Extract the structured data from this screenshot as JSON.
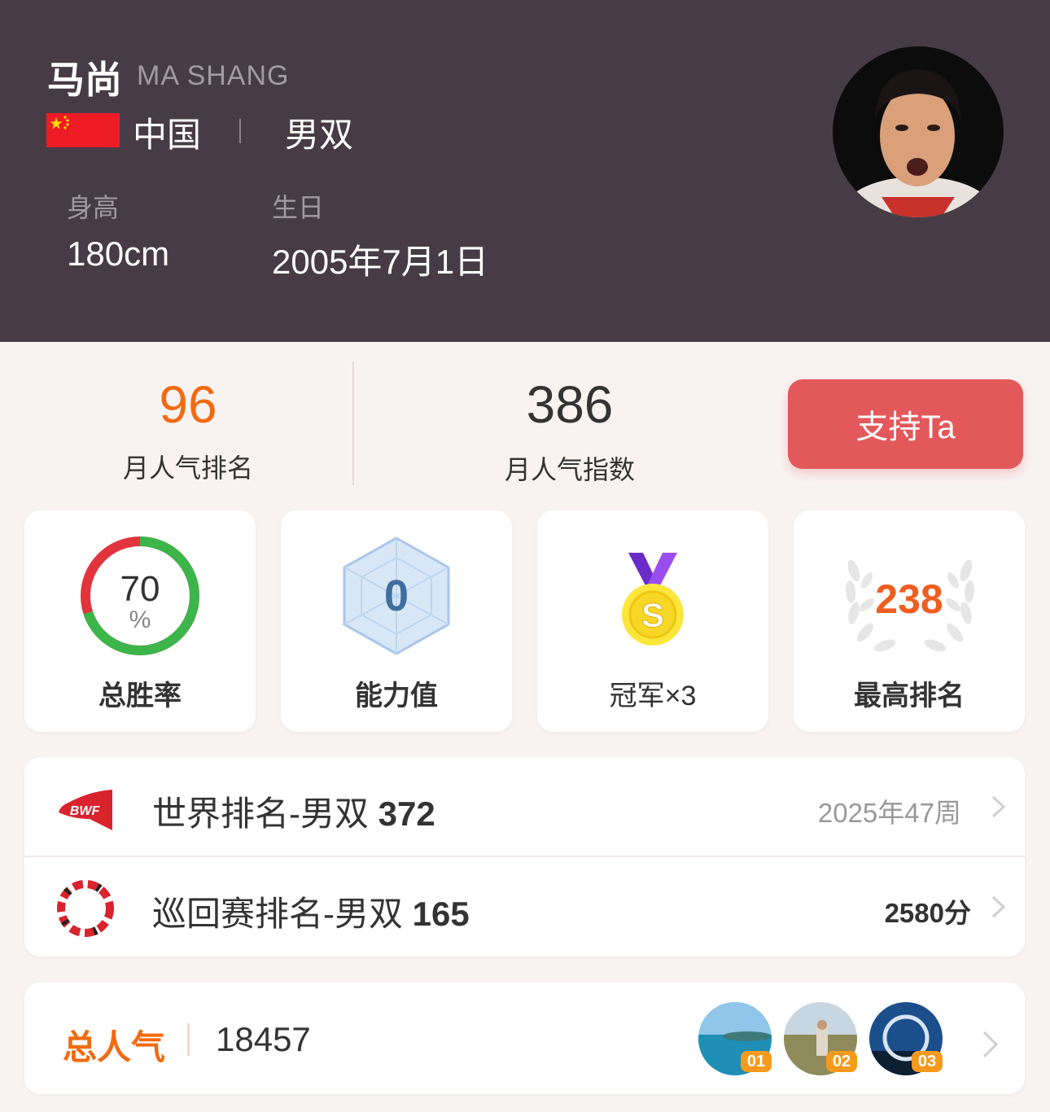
{
  "player": {
    "name_cn": "马尚",
    "name_en": "MA SHANG",
    "country": "中国",
    "separator": "|",
    "event": "男双",
    "height_label": "身高",
    "height_value": "180cm",
    "birthday_label": "生日",
    "birthday_value": "2005年7月1日"
  },
  "popularity_stats": {
    "monthly_rank_value": "96",
    "monthly_rank_label": "月人气排名",
    "monthly_index_value": "386",
    "monthly_index_label": "月人气指数",
    "support_button": "支持Ta"
  },
  "cards": {
    "win_rate": {
      "value": "70",
      "unit": "%",
      "label": "总胜率",
      "percent": 70
    },
    "ability": {
      "value": "0",
      "label": "能力值"
    },
    "champion": {
      "medal_letter": "S",
      "label": "冠军×3"
    },
    "best_rank": {
      "value": "238",
      "label": "最高排名"
    }
  },
  "rankings": {
    "world": {
      "title": "世界排名-男双",
      "value": "372",
      "right": "2025年47周",
      "logo_text": "BWF"
    },
    "tour": {
      "title": "巡回赛排名-男双",
      "value": "165",
      "right": "2580分"
    }
  },
  "total_popularity": {
    "label": "总人气",
    "value": "18457",
    "fans": [
      {
        "badge": "01"
      },
      {
        "badge": "02"
      },
      {
        "badge": "03"
      }
    ]
  },
  "colors": {
    "header_bg": "#473c45",
    "accent_orange": "#f26a12",
    "button_red": "#e3585a",
    "win_green": "#3cb54a",
    "loss_red": "#e2343c"
  }
}
